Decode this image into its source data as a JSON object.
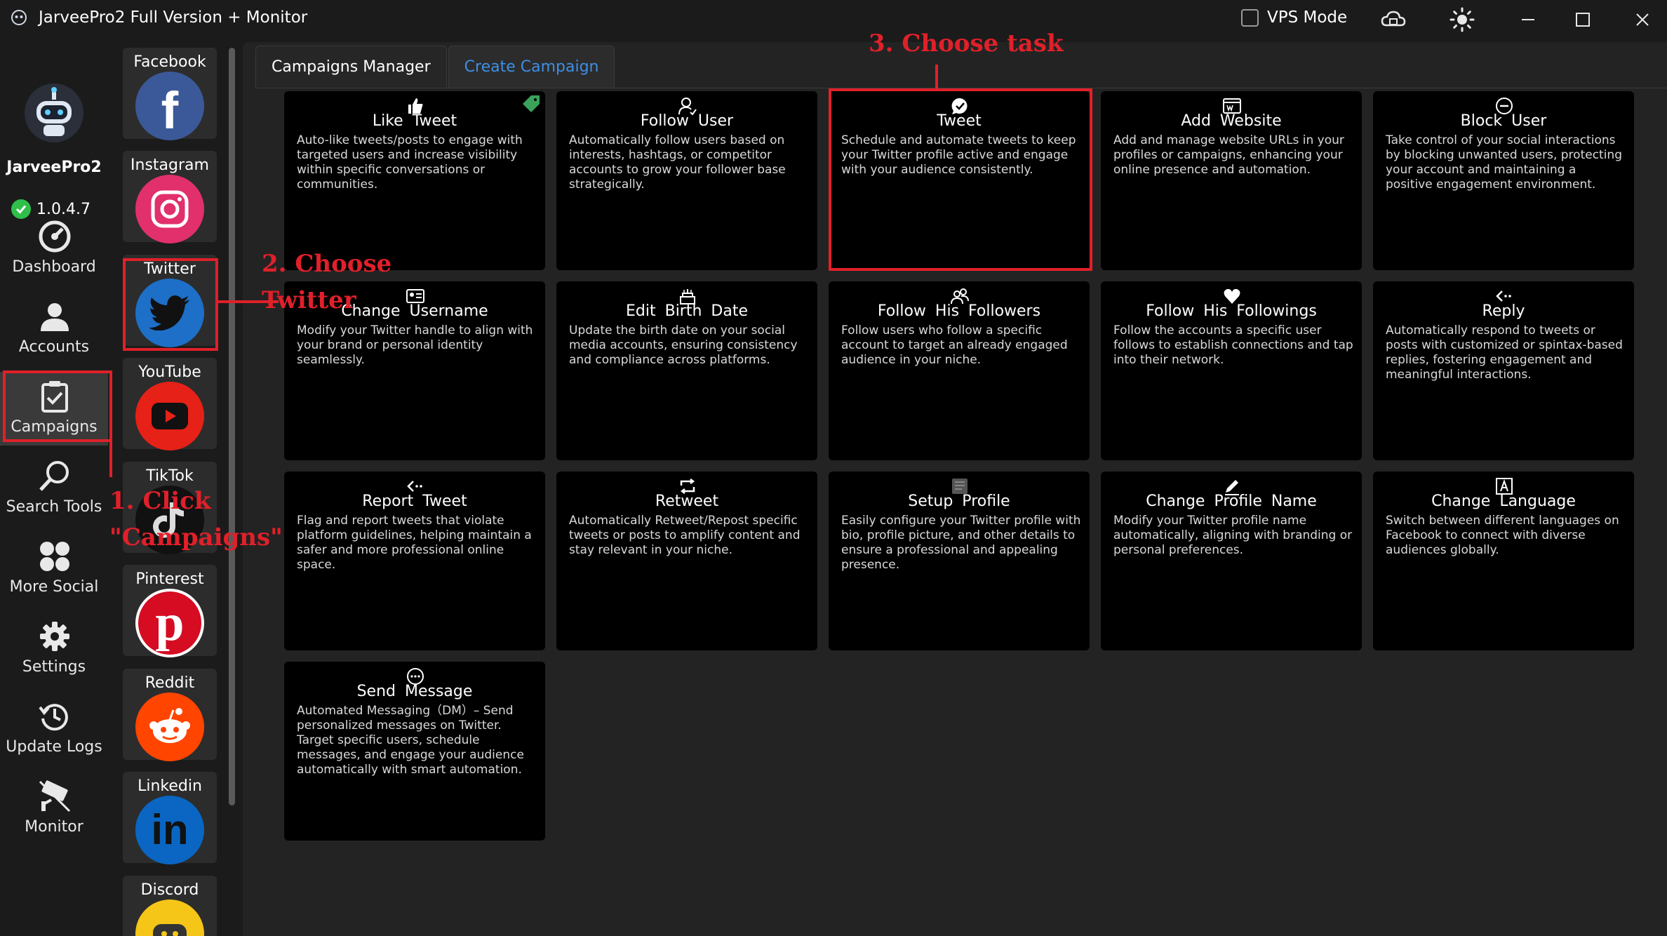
{
  "window": {
    "title": "JarveePro2 Full Version + Monitor",
    "vps_mode_label": "VPS Mode",
    "vps_mode_checked": false
  },
  "brand": {
    "name": "JarveePro2",
    "version": "1.0.4.7"
  },
  "nav": [
    {
      "label": "Dashboard",
      "icon": "dashboard-gauge-icon"
    },
    {
      "label": "Accounts",
      "icon": "accounts-user-icon"
    },
    {
      "label": "Campaigns",
      "icon": "campaigns-clipboard-icon",
      "active": true
    },
    {
      "label": "Search Tools",
      "icon": "search-magnifier-icon"
    },
    {
      "label": "More Social",
      "icon": "more-social-grid-icon"
    },
    {
      "label": "Settings",
      "icon": "settings-gear-icon"
    },
    {
      "label": "Update Logs",
      "icon": "update-logs-clock-icon"
    },
    {
      "label": "Monitor",
      "icon": "monitor-camera-icon"
    }
  ],
  "social": [
    {
      "label": "Facebook",
      "icon": "facebook-icon",
      "color": "#3b5998"
    },
    {
      "label": "Instagram",
      "icon": "instagram-icon",
      "color": "#e1306c"
    },
    {
      "label": "Twitter",
      "icon": "twitter-icon",
      "color": "#1d6fc7",
      "selected": true
    },
    {
      "label": "YouTube",
      "icon": "youtube-icon",
      "color": "#e62117"
    },
    {
      "label": "TikTok",
      "icon": "tiktok-icon",
      "color": "#111111"
    },
    {
      "label": "Pinterest",
      "icon": "pinterest-icon",
      "color": "#d50c22"
    },
    {
      "label": "Reddit",
      "icon": "reddit-icon",
      "color": "#ff4500"
    },
    {
      "label": "Linkedin",
      "icon": "linkedin-icon",
      "color": "#0a66c2"
    },
    {
      "label": "Discord",
      "icon": "discord-icon",
      "color": "#f5c518"
    }
  ],
  "tabs": [
    {
      "label": "Campaigns Manager",
      "active": false
    },
    {
      "label": "Create Campaign",
      "active": true
    }
  ],
  "tasks": [
    {
      "title": "Like  Tweet",
      "icon": "thumbs-up-icon",
      "desc": "Auto-like tweets/posts to engage with targeted users and increase visibility within specific conversations or communities."
    },
    {
      "title": "Follow  User",
      "icon": "follow-user-icon",
      "desc": "Automatically follow users based on interests, hashtags, or competitor accounts to grow your follower base strategically."
    },
    {
      "title": "Tweet",
      "icon": "tweet-icon",
      "desc": "Schedule and automate tweets to keep your Twitter profile active and engage with your audience consistently."
    },
    {
      "title": "Add  Website",
      "icon": "website-icon",
      "desc": "Add and manage website URLs in your profiles or campaigns, enhancing your online presence and automation."
    },
    {
      "title": "Block  User",
      "icon": "block-user-icon",
      "desc": "Take control of your social interactions by blocking unwanted users, protecting your account and maintaining a positive engagement environment."
    },
    {
      "title": "Change  Username",
      "icon": "username-card-icon",
      "desc": "Modify your Twitter handle to align with your brand or personal identity seamlessly."
    },
    {
      "title": "Edit  Birth  Date",
      "icon": "birthday-cake-icon",
      "desc": "Update the birth date on your social media accounts, ensuring consistency and compliance across platforms."
    },
    {
      "title": "Follow  His  Followers",
      "icon": "followers-icon",
      "desc": "Follow users who follow a specific account to target an already engaged audience in your niche."
    },
    {
      "title": "Follow  His  Followings",
      "icon": "followings-heart-icon",
      "desc": "Follow the accounts a specific user follows to establish connections and tap into their network."
    },
    {
      "title": "Reply",
      "icon": "reply-icon",
      "desc": "Automatically respond to tweets or posts with customized or spintax-based replies, fostering engagement and meaningful interactions."
    },
    {
      "title": "Report  Tweet",
      "icon": "report-icon",
      "desc": "Flag and report tweets that violate platform guidelines, helping maintain a safer and more professional online space."
    },
    {
      "title": "Retweet",
      "icon": "retweet-icon",
      "desc": "Automatically Retweet/Repost specific tweets or posts to amplify content and stay relevant in your niche."
    },
    {
      "title": "Setup  Profile",
      "icon": "setup-profile-icon",
      "desc": "Easily configure your Twitter profile with bio, profile picture, and other details to ensure a professional and appealing presence."
    },
    {
      "title": "Change  Profile  Name",
      "icon": "pencil-icon",
      "desc": "Modify your Twitter profile name automatically, aligning with branding or personal preferences."
    },
    {
      "title": "Change  Language",
      "icon": "language-icon",
      "desc": "Switch between different languages on Facebook to connect with diverse audiences globally."
    },
    {
      "title": "Send  Message",
      "icon": "message-icon",
      "desc": "Automated  Messaging（DM）– Send personalized messages on Twitter. Target specific users, schedule messages, and engage your audience automatically with smart automation."
    }
  ],
  "annotations": {
    "step1_line1": "1. Click",
    "step1_line2": "\"Campaigns\"",
    "step2_line1": "2. Choose",
    "step2_line2": "Twitter",
    "step3": "3. Choose task"
  },
  "colors": {
    "accent": "#3d8fe6",
    "annotation": "#e0202a",
    "card_bg": "#000000",
    "panel_bg": "#232323"
  }
}
